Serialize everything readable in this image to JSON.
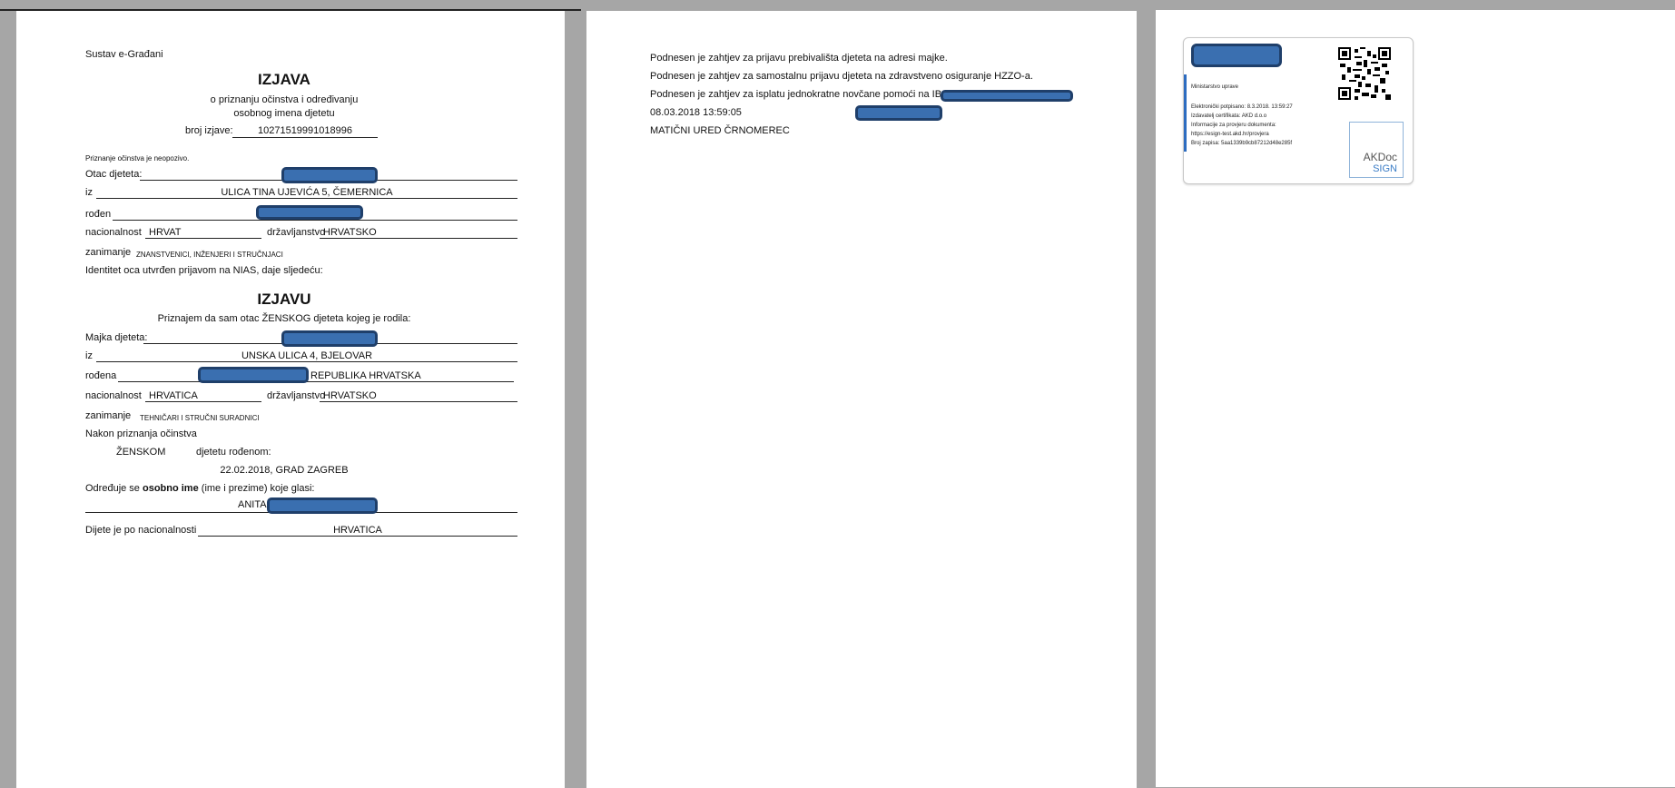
{
  "page1": {
    "system": "Sustav e-Građani",
    "title": "IZJAVA",
    "subtitle1": "o priznanju očinstva i određivanju",
    "subtitle2": "osobnog imena djetetu",
    "broj_label": "broj izjave:",
    "broj_value": "10271519991018996",
    "irrevocable": "Priznanje očinstva je neopozivo.",
    "otac_label": "Otac djeteta:",
    "iz_label": "iz",
    "otac_address": "ULICA TINA UJEVIĆA 5, ČEMERNICA",
    "rodjen_label": "rođen",
    "nac_label": "nacionalnost",
    "otac_nac": "HRVAT",
    "drz_label": "državljanstvo",
    "otac_drz": "HRVATSKO",
    "zan_label": "zanimanje",
    "otac_zan": "ZNANSTVENICI, INŽENJERI I STRUČNJACI",
    "identity": "Identitet oca utvrđen prijavom na NIAS, daje sljedeću:",
    "title2": "IZJAVU",
    "priznajem": "Priznajem da sam otac ŽENSKOG djeteta kojeg je rodila:",
    "majka_label": "Majka djeteta:",
    "majka_address": "UNSKA ULICA 4, BJELOVAR",
    "rodjena_label": "rođena",
    "majka_rodjena": "REPUBLIKA HRVATSKA",
    "majka_nac": "HRVATICA",
    "majka_drz": "HRVATSKO",
    "majka_zan": "TEHNIČARI I STRUČNI SURADNICI",
    "nakon": "Nakon priznanja očinstva",
    "spol": "ŽENSKOM",
    "djetetu": "djetetu rođenom:",
    "datum_mjesto": "22.02.2018, GRAD ZAGREB",
    "odredjuje_pre": "Određuje se ",
    "odredjuje_bold": "osobno ime",
    "odredjuje_post": " (ime i prezime) koje glasi:",
    "ime": "ANITA",
    "dijete_nac_label": "Dijete je po nacionalnosti",
    "dijete_nac": "HRVATICA"
  },
  "page2": {
    "line1": "Podnesen je zahtjev za prijavu prebivališta djeteta na adresi majke.",
    "line2": "Podnesen je zahtjev za samostalnu prijavu djeteta na zdravstveno osiguranje HZZO-a.",
    "line3": "Podnesen je zahtjev za isplatu jednokratne novčane pomoći na IBAN H",
    "timestamp": "08.03.2018 13:59:05",
    "office": "MATIČNI URED ČRNOMEREC"
  },
  "stamp": {
    "ministry": "Ministarstvo uprave",
    "signed": "Elektronički potpisano: 8.3.2018. 13:59:27",
    "issuer": "Izdavatelj certifikata: AKD d.o.o",
    "info": "Informacije za provjeru dokumenta:",
    "url": "https://esign-test.akd.hr/provjera",
    "record": "Broj zapisa: 5aa1339b9cb87212d48e285f",
    "logo_top": "AKDoc",
    "logo_bottom": "SIGN"
  },
  "colors": {
    "redaction": "#3a6fb0",
    "redaction_border": "#1f3f6a",
    "accent": "#2d6cc0"
  }
}
